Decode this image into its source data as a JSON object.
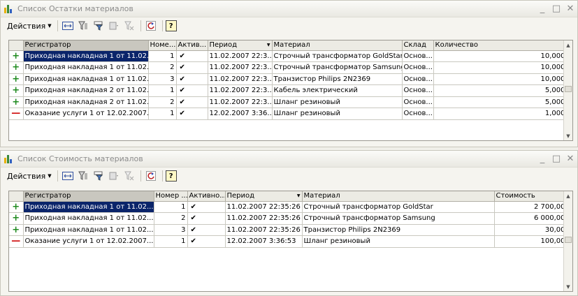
{
  "window1": {
    "title": "Список Остатки материалов",
    "actions_label": "Действия",
    "columns": [
      "Регистратор",
      "Номе...",
      "Актив...",
      "Период",
      "Материал",
      "Склад",
      "Количество"
    ],
    "rows": [
      {
        "type": "plus",
        "registrator": "Приходная накладная 1 от 11.02...",
        "line": "1",
        "active": "✔",
        "period": "11.02.2007 22:3...",
        "material": "Строчный трансформатор GoldStar",
        "warehouse": "Основ...",
        "qty": "10,000"
      },
      {
        "type": "plus",
        "registrator": "Приходная накладная 1 от 11.02...",
        "line": "2",
        "active": "✔",
        "period": "11.02.2007 22:3...",
        "material": "Строчный трансформатор Samsung",
        "warehouse": "Основ...",
        "qty": "10,000"
      },
      {
        "type": "plus",
        "registrator": "Приходная накладная 1 от 11.02...",
        "line": "3",
        "active": "✔",
        "period": "11.02.2007 22:3...",
        "material": "Транзистор Philips 2N2369",
        "warehouse": "Основ...",
        "qty": "10,000"
      },
      {
        "type": "plus",
        "registrator": "Приходная накладная 2 от 11.02...",
        "line": "1",
        "active": "✔",
        "period": "11.02.2007 22:3...",
        "material": "Кабель электрический",
        "warehouse": "Основ...",
        "qty": "5,000"
      },
      {
        "type": "plus",
        "registrator": "Приходная накладная 2 от 11.02...",
        "line": "2",
        "active": "✔",
        "period": "11.02.2007 22:3...",
        "material": "Шланг резиновый",
        "warehouse": "Основ...",
        "qty": "5,000"
      },
      {
        "type": "minus",
        "registrator": "Оказание услуги 1 от 12.02.2007...",
        "line": "1",
        "active": "✔",
        "period": "12.02.2007 3:36...",
        "material": "Шланг резиновый",
        "warehouse": "Основ...",
        "qty": "1,000"
      }
    ]
  },
  "window2": {
    "title": "Список Стоимость материалов",
    "actions_label": "Действия",
    "columns": [
      "Регистратор",
      "Номер ...",
      "Активно...",
      "Период",
      "Материал",
      "Стоимость"
    ],
    "rows": [
      {
        "type": "plus",
        "registrator": "Приходная накладная 1 от 11.02...",
        "line": "1",
        "active": "✔",
        "period": "11.02.2007 22:35:26",
        "material": "Строчный трансформатор GoldStar",
        "cost": "2 700,00"
      },
      {
        "type": "plus",
        "registrator": "Приходная накладная 1 от 11.02...",
        "line": "2",
        "active": "✔",
        "period": "11.02.2007 22:35:26",
        "material": "Строчный трансформатор Samsung",
        "cost": "6 000,00"
      },
      {
        "type": "plus",
        "registrator": "Приходная накладная 1 от 11.02...",
        "line": "3",
        "active": "✔",
        "period": "11.02.2007 22:35:26",
        "material": "Транзистор Philips 2N2369",
        "cost": "30,00"
      },
      {
        "type": "minus",
        "registrator": "Оказание услуги 1 от 12.02.2007...",
        "line": "1",
        "active": "✔",
        "period": "12.02.2007 3:36:53",
        "material": "Шланг резиновый",
        "cost": "100,00"
      }
    ]
  },
  "icons": {
    "plus": "+",
    "minus": "—",
    "help": "?",
    "minimize": "_",
    "maximize": "□",
    "close": "✕",
    "sort_desc": "▼",
    "dropdown": "▼"
  },
  "colors": {
    "selection": "#0a246a",
    "plus": "#1e8a1e",
    "minus": "#d01010"
  }
}
